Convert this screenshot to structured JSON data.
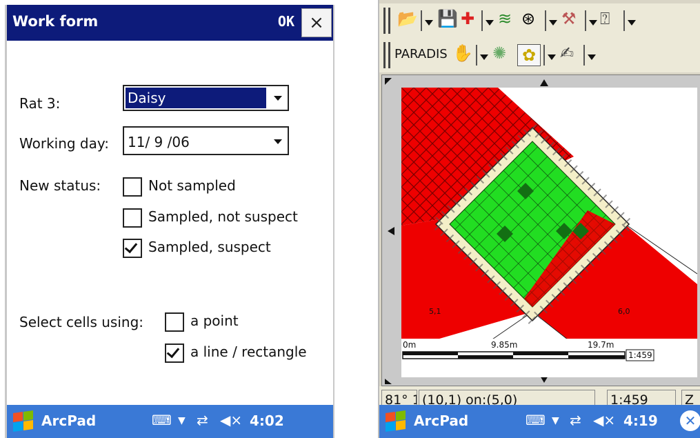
{
  "left_window": {
    "title": "Work form",
    "ok_label": "OK",
    "close_label": "×",
    "rat_label": "Rat 3:",
    "rat_value": "Daisy",
    "working_day_label": "Working day:",
    "working_day_value": "11/ 9 /06",
    "new_status_label": "New status:",
    "status_options": [
      {
        "label": "Not sampled",
        "checked": false
      },
      {
        "label": "Sampled, not suspect",
        "checked": false
      },
      {
        "label": "Sampled, suspect",
        "checked": true
      }
    ],
    "select_cells_label": "Select cells using:",
    "select_options": [
      {
        "label": "a point",
        "checked": false
      },
      {
        "label": "a line / rectangle",
        "checked": true
      }
    ]
  },
  "left_taskbar": {
    "app": "ArcPad",
    "clock": "4:02"
  },
  "right_window": {
    "toolbar_label": "PARADIS",
    "map_labels": {
      "area_left": "5,1",
      "area_right": "6,0"
    },
    "scale_bar": {
      "start": "0m",
      "mid": "9.85m",
      "end": "19.7m",
      "ratio": "1:459"
    },
    "status_bar": {
      "angle": "81° 1",
      "position": "(10,1) on:(5,0)",
      "scale": "1:459",
      "zoom": "Z"
    }
  },
  "right_taskbar": {
    "app": "ArcPad",
    "clock": "4:19"
  },
  "colors": {
    "titlebar": "#0d1b7a",
    "taskbar": "#3a79d6",
    "map_red": "#ee0000",
    "map_green": "#22dd22",
    "map_dark_green": "#136f13",
    "map_cream": "#f4efc8"
  },
  "icons": [
    "windows-flag-icon",
    "keyboard-icon",
    "connectivity-icon",
    "volume-icon",
    "close-circle-icon"
  ]
}
